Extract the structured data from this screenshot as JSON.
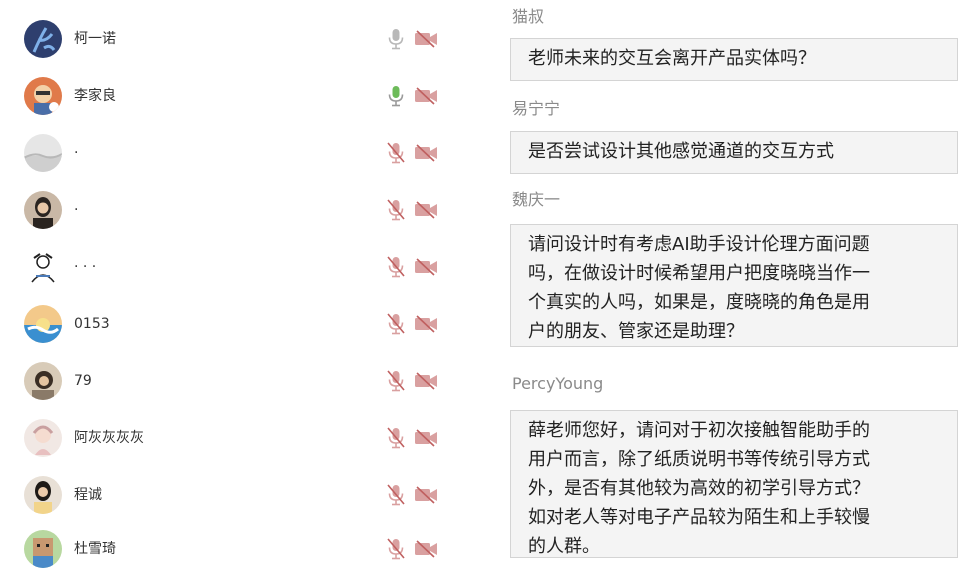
{
  "participants": [
    {
      "name": "柯一诺",
      "mic_active": false,
      "avatar": "dark-blue-figure-avatar"
    },
    {
      "name": "李家良",
      "mic_active": true,
      "avatar": "cartoon-avatar"
    },
    {
      "name": "·",
      "mic_active": false,
      "avatar": "landscape-avatar"
    },
    {
      "name": "·",
      "mic_active": false,
      "avatar": "person-portrait-avatar"
    },
    {
      "name": "· · ·",
      "mic_active": false,
      "avatar": "sketch-avatar"
    },
    {
      "name": "0153",
      "mic_active": false,
      "avatar": "sunset-avatar"
    },
    {
      "name": "79",
      "mic_active": false,
      "avatar": "photo-avatar"
    },
    {
      "name": "阿灰灰灰灰",
      "mic_active": false,
      "avatar": "illustration-avatar"
    },
    {
      "name": "程诚",
      "mic_active": false,
      "avatar": "person-portrait-avatar"
    },
    {
      "name": "杜雪琦",
      "mic_active": false,
      "avatar": "pixel-character-avatar"
    }
  ],
  "messages": [
    {
      "sender": "猫叔",
      "lines": [
        "老师未来的交互会离开产品实体吗？"
      ]
    },
    {
      "sender": "易宁宁",
      "lines": [
        "是否尝试设计其他感觉通道的交互方式"
      ]
    },
    {
      "sender": "魏庆一",
      "lines": [
        "请问设计时有考虑AI助手设计伦理方面问题",
        "吗，在做设计时候希望用户把度晓晓当作一",
        "个真实的人吗，如果是，度晓晓的角色是用",
        "户的朋友、管家还是助理？"
      ]
    },
    {
      "sender": "PercyYoung",
      "lines": [
        "薛老师您好，请问对于初次接触智能助手的",
        "用户而言，除了纸质说明书等传统引导方式",
        "外，是否有其他较为高效的初学引导方式？",
        "如对老人等对电子产品较为陌生和上手较慢",
        "的人群。"
      ]
    }
  ],
  "colors": {
    "mic_muted": "#d9a0a0",
    "mic_active": "#6dbb5a",
    "cam_off": "#d9a0a0",
    "bubble_bg": "#f4f4f4",
    "bubble_border": "#d4d4d4",
    "sender_name": "#8a8a8a"
  }
}
